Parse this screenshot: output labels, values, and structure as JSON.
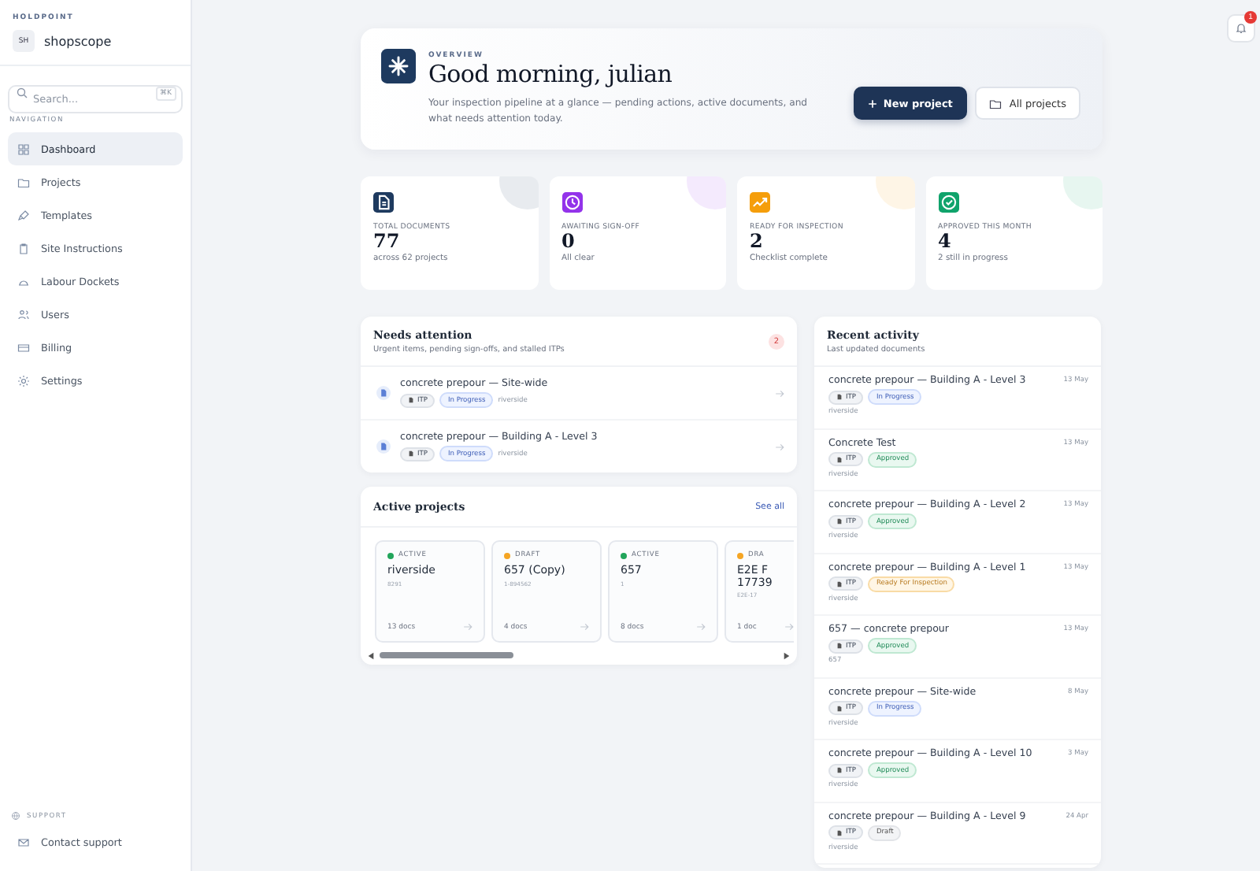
{
  "sidebar": {
    "org_label": "HOLDPOINT",
    "workspace": {
      "initials": "SH",
      "name": "shopscope"
    },
    "search": {
      "placeholder": "Search...",
      "shortcut": "⌘K"
    },
    "nav_label": "NAVIGATION",
    "items": [
      {
        "label": "Dashboard",
        "selected": true
      },
      {
        "label": "Projects",
        "selected": false
      },
      {
        "label": "Templates",
        "selected": false
      },
      {
        "label": "Site Instructions",
        "selected": false
      },
      {
        "label": "Labour Dockets",
        "selected": false
      },
      {
        "label": "Users",
        "selected": false
      },
      {
        "label": "Billing",
        "selected": false
      },
      {
        "label": "Settings",
        "selected": false
      }
    ],
    "support_label": "SUPPORT",
    "support_link": "Contact support"
  },
  "notifications": {
    "count": "1"
  },
  "hero": {
    "eyebrow": "OVERVIEW",
    "title": "Good morning, julian",
    "subtitle": "Your inspection pipeline at a glance — pending actions, active documents, and what needs attention today.",
    "primary_button": "New project",
    "secondary_button": "All projects"
  },
  "stats": [
    {
      "kind": "documents",
      "label": "TOTAL DOCUMENTS",
      "value": "77",
      "note": "across 62 projects",
      "color": "#1e3a5f"
    },
    {
      "kind": "clock",
      "label": "AWAITING SIGN-OFF",
      "value": "0",
      "note": "All clear",
      "color": "#9333ea"
    },
    {
      "kind": "trend",
      "label": "READY FOR INSPECTION",
      "value": "2",
      "note": "Checklist complete",
      "color": "#f59e0b"
    },
    {
      "kind": "check",
      "label": "APPROVED THIS MONTH",
      "value": "4",
      "note": "2 still in progress",
      "color": "#10a36b"
    }
  ],
  "needs_attention": {
    "title": "Needs attention",
    "subtitle": "Urgent items, pending sign-offs, and stalled ITPs",
    "count": "2",
    "items": [
      {
        "title": "concrete prepour — Site-wide",
        "type": "ITP",
        "status": {
          "kind": "in_progress",
          "label": "In Progress"
        },
        "project": "riverside"
      },
      {
        "title": "concrete prepour — Building A - Level 3",
        "type": "ITP",
        "status": {
          "kind": "in_progress",
          "label": "In Progress"
        },
        "project": "riverside"
      }
    ]
  },
  "active_projects": {
    "title": "Active projects",
    "link": "See all",
    "projects": [
      {
        "status": "ACTIVE",
        "color": "#22a55b",
        "name": "riverside",
        "code": "8291",
        "docs": "13 docs"
      },
      {
        "status": "DRAFT",
        "color": "#f5a524",
        "name": "657 (Copy)",
        "code": "1-894562",
        "docs": "4 docs"
      },
      {
        "status": "ACTIVE",
        "color": "#22a55b",
        "name": "657",
        "code": "1",
        "docs": "8 docs"
      },
      {
        "status": "DRA",
        "color": "#f5a524",
        "name": "E2E F 17739",
        "code": "E2E-17",
        "docs": "1 doc"
      }
    ]
  },
  "recent_activity": {
    "title": "Recent activity",
    "subtitle": "Last updated documents",
    "items": [
      {
        "title": "concrete prepour — Building A - Level 3",
        "date": "13 May",
        "type": "ITP",
        "status": {
          "kind": "in_progress",
          "label": "In Progress"
        },
        "project": "riverside"
      },
      {
        "title": "Concrete Test",
        "date": "13 May",
        "type": "ITP",
        "status": {
          "kind": "approved",
          "label": "Approved"
        },
        "project": "riverside"
      },
      {
        "title": "concrete prepour — Building A - Level 2",
        "date": "13 May",
        "type": "ITP",
        "status": {
          "kind": "approved",
          "label": "Approved"
        },
        "project": "riverside"
      },
      {
        "title": "concrete prepour — Building A - Level 1",
        "date": "13 May",
        "type": "ITP",
        "status": {
          "kind": "ready",
          "label": "Ready For Inspection"
        },
        "project": "riverside"
      },
      {
        "title": "657 — concrete prepour",
        "date": "13 May",
        "type": "ITP",
        "status": {
          "kind": "approved",
          "label": "Approved"
        },
        "project": "657"
      },
      {
        "title": "concrete prepour — Site-wide",
        "date": "8 May",
        "type": "ITP",
        "status": {
          "kind": "in_progress",
          "label": "In Progress"
        },
        "project": "riverside"
      },
      {
        "title": "concrete prepour — Building A - Level 10",
        "date": "3 May",
        "type": "ITP",
        "status": {
          "kind": "approved",
          "label": "Approved"
        },
        "project": "riverside"
      },
      {
        "title": "concrete prepour — Building A - Level 9",
        "date": "24 Apr",
        "type": "ITP",
        "status": {
          "kind": "draft",
          "label": "Draft"
        },
        "project": "riverside"
      }
    ]
  }
}
